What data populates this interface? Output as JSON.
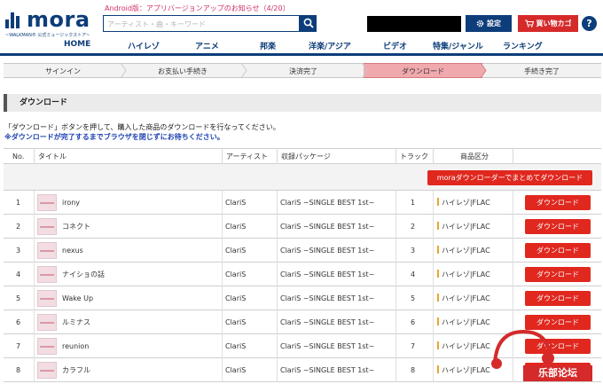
{
  "header": {
    "logo_word": "mora",
    "logo_tagline": "~WALKMAN® 公式ミュージックストア~",
    "notice": "Android版：アプリバージョンアップのお知らせ（4/20）",
    "search_placeholder": "アーティスト・曲・キーワード",
    "settings_label": "設定",
    "cart_label": "買い物カゴ",
    "help_label": "?"
  },
  "nav": {
    "items": [
      "HOME",
      "ハイレゾ",
      "アニメ",
      "邦楽",
      "洋楽/アジア",
      "ビデオ",
      "特集/ジャンル",
      "ランキング"
    ]
  },
  "steps": [
    "サインイン",
    "お支払い手続き",
    "決済完了",
    "ダウンロード",
    "手続き完了"
  ],
  "active_step": 3,
  "section": {
    "title": "ダウンロード",
    "desc1": "「ダウンロード」ボタンを押して、購入した商品のダウンロードを行なってください。",
    "desc2": "※ダウンロードが完了するまでブラウザを閉じずにお待ちください。"
  },
  "table": {
    "headers": {
      "no": "No.",
      "title": "タイトル",
      "artist": "アーティスト",
      "package": "収録パッケージ",
      "track": "トラック",
      "type": "商品区分"
    },
    "bulk_button": "moraダウンローダーでまとめてダウンロード",
    "download_label": "ダウンロード",
    "rows": [
      {
        "no": "1",
        "title": "irony",
        "artist": "ClariS",
        "package": "ClariS ~SINGLE BEST 1st~",
        "track": "1",
        "type": "ハイレゾ|FLAC"
      },
      {
        "no": "2",
        "title": "コネクト",
        "artist": "ClariS",
        "package": "ClariS ~SINGLE BEST 1st~",
        "track": "2",
        "type": "ハイレゾ|FLAC"
      },
      {
        "no": "3",
        "title": "nexus",
        "artist": "ClariS",
        "package": "ClariS ~SINGLE BEST 1st~",
        "track": "3",
        "type": "ハイレゾ|FLAC"
      },
      {
        "no": "4",
        "title": "ナイショの話",
        "artist": "ClariS",
        "package": "ClariS ~SINGLE BEST 1st~",
        "track": "4",
        "type": "ハイレゾ|FLAC"
      },
      {
        "no": "5",
        "title": "Wake Up",
        "artist": "ClariS",
        "package": "ClariS ~SINGLE BEST 1st~",
        "track": "5",
        "type": "ハイレゾ|FLAC"
      },
      {
        "no": "6",
        "title": "ルミナス",
        "artist": "ClariS",
        "package": "ClariS ~SINGLE BEST 1st~",
        "track": "6",
        "type": "ハイレゾ|FLAC"
      },
      {
        "no": "7",
        "title": "reunion",
        "artist": "ClariS",
        "package": "ClariS ~SINGLE BEST 1st~",
        "track": "7",
        "type": "ハイレゾ|FLAC"
      },
      {
        "no": "8",
        "title": "カラフル",
        "artist": "ClariS",
        "package": "ClariS ~SINGLE BEST 1st~",
        "track": "8",
        "type": "ハイレゾ|FLAC"
      }
    ]
  },
  "watermark": {
    "text": "乐部论坛"
  },
  "colors": {
    "brand_navy": "#0d3d7a",
    "action_red": "#e0281f",
    "step_active": "#f0a9ad",
    "notice_pink": "#d0306a",
    "warning_blue": "#1a3fb0"
  }
}
